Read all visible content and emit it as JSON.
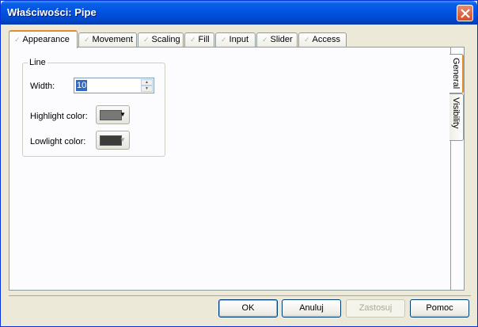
{
  "window": {
    "title": "Właściwości: Pipe"
  },
  "tabs": [
    {
      "label": "Appearance"
    },
    {
      "label": "Movement"
    },
    {
      "label": "Scaling"
    },
    {
      "label": "Fill"
    },
    {
      "label": "Input"
    },
    {
      "label": "Slider"
    },
    {
      "label": "Access"
    }
  ],
  "side_tabs": [
    {
      "label": "General"
    },
    {
      "label": "Visibility"
    }
  ],
  "line_group": {
    "title": "Line",
    "width_label": "Width:",
    "width_value": "10",
    "highlight_label": "Highlight color:",
    "lowlight_label": "Lowlight color:",
    "highlight_color": "#777777",
    "lowlight_color": "#3c3c3c"
  },
  "buttons": {
    "ok": "OK",
    "cancel": "Anuluj",
    "apply": "Zastosuj",
    "help": "Pomoc"
  }
}
